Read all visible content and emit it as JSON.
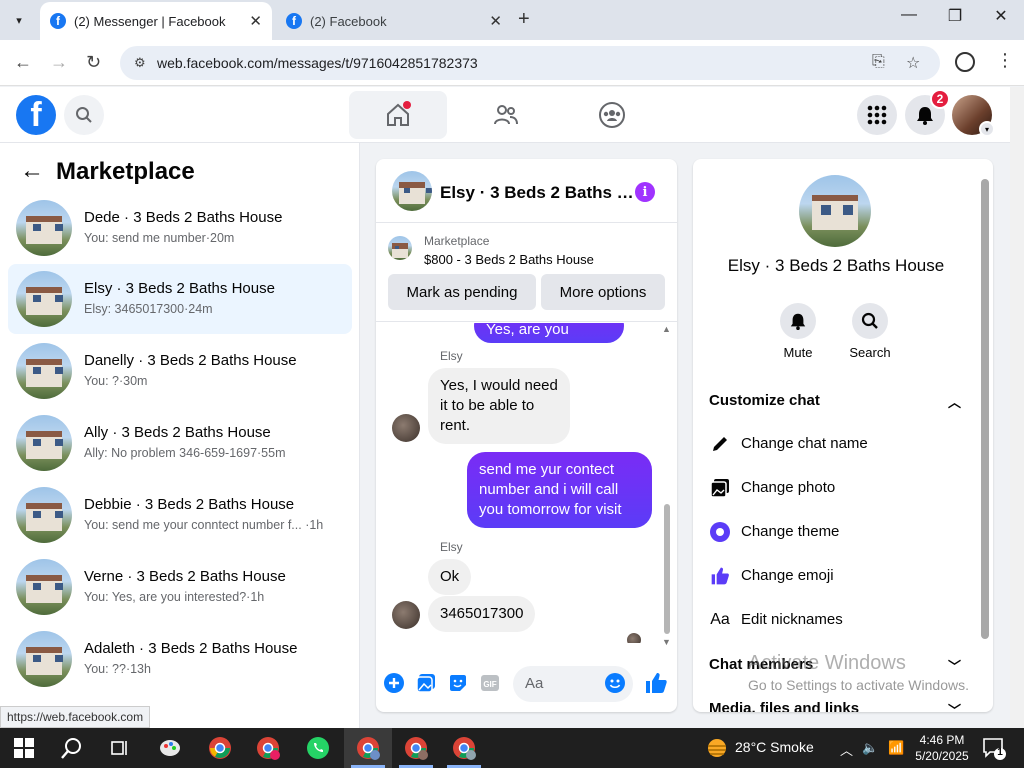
{
  "browser": {
    "tabs": [
      {
        "title": "(2) Messenger | Facebook",
        "active": true
      },
      {
        "title": "(2) Facebook",
        "active": false
      }
    ],
    "url": "web.facebook.com/messages/t/9716042851782373",
    "status_url": "https://web.facebook.com"
  },
  "header": {
    "notification_count": "2"
  },
  "marketplace": {
    "title": "Marketplace",
    "conversations": [
      {
        "name": "Dede · 3 Beds 2 Baths House",
        "preview": "You: send me number·20m"
      },
      {
        "name": "Elsy · 3 Beds 2 Baths House",
        "preview": "Elsy: 3465017300·24m"
      },
      {
        "name": "Danelly · 3 Beds 2 Baths House",
        "preview": "You: ?·30m"
      },
      {
        "name": "Ally · 3 Beds 2 Baths House",
        "preview": "Ally: No problem 346-659-1697·55m"
      },
      {
        "name": "Debbie · 3 Beds 2 Baths House",
        "preview": "You: send me your conntect number f... ·1h"
      },
      {
        "name": "Verne · 3 Beds 2 Baths House",
        "preview": "You: Yes, are you interested?·1h"
      },
      {
        "name": "Adaleth · 3 Beds 2 Baths House",
        "preview": "You: ??·13h"
      }
    ]
  },
  "chat": {
    "title": "Elsy · 3 Beds 2 Baths …",
    "listing_label": "Marketplace",
    "listing_detail": "$800 - 3 Beds 2 Baths House",
    "mark_pending": "Mark as pending",
    "more_options": "More options",
    "messages": [
      {
        "from": "me",
        "text": "Yes, are you interested?"
      },
      {
        "sender": "Elsy",
        "from": "them",
        "text": "Yes, I would need it to be able to rent."
      },
      {
        "from": "me",
        "text": "send me yur contect number and i will call you tomorrow for visit"
      },
      {
        "sender": "Elsy",
        "from": "them",
        "text": "Ok"
      },
      {
        "from": "them",
        "text": "3465017300"
      }
    ],
    "composer_placeholder": "Aa"
  },
  "info_panel": {
    "name": "Elsy · 3 Beds 2 Baths House",
    "actions": [
      {
        "label": "Mute",
        "icon": "bell-icon"
      },
      {
        "label": "Search",
        "icon": "search-icon"
      }
    ],
    "customize_label": "Customize chat",
    "customize_items": [
      {
        "label": "Change chat name",
        "icon": "pencil-icon"
      },
      {
        "label": "Change photo",
        "icon": "photo-icon"
      },
      {
        "label": "Change theme",
        "icon": "theme-icon"
      },
      {
        "label": "Change emoji",
        "icon": "thumbs-up-icon"
      },
      {
        "label": "Edit nicknames",
        "icon": "aa-icon"
      }
    ],
    "chat_members_label": "Chat members",
    "media_label": "Media, files and links",
    "watermark_1": "Activate Windows",
    "watermark_2": "Go to Settings to activate Windows."
  },
  "taskbar": {
    "weather": "28°C  Smoke",
    "time": "4:46 PM",
    "date": "5/20/2025",
    "notif_count": "1"
  },
  "colors": {
    "fb_blue": "#1877f2",
    "messenger_purple": "#7a2cf5",
    "active_conv": "#ebf5ff"
  }
}
